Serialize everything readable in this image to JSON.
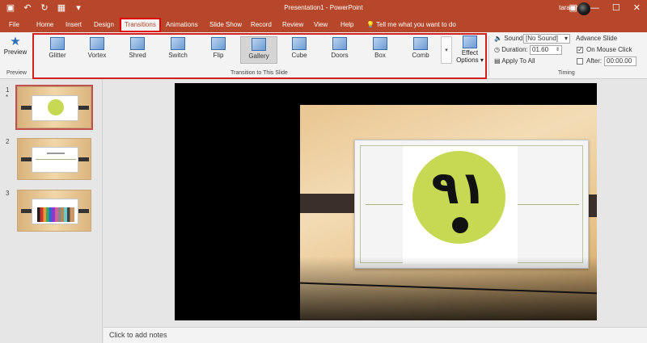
{
  "window": {
    "title": "Presentation1 - PowerPoint",
    "user": "taran n"
  },
  "tabs": [
    "File",
    "Home",
    "Insert",
    "Design",
    "Transitions",
    "Animations",
    "Slide Show",
    "Record",
    "Review",
    "View",
    "Help"
  ],
  "active_tab": "Transitions",
  "tell_me": "Tell me what you want to do",
  "ribbon": {
    "preview": {
      "label": "Preview",
      "group": "Preview"
    },
    "transitions": {
      "group": "Transition to This Slide",
      "items": [
        "Glitter",
        "Vortex",
        "Shred",
        "Switch",
        "Flip",
        "Gallery",
        "Cube",
        "Doors",
        "Box",
        "Comb"
      ],
      "selected": "Gallery",
      "effect_options_line1": "Effect",
      "effect_options_line2": "Options"
    },
    "timing": {
      "group": "Timing",
      "sound_label": "Sound:",
      "sound_value": "[No Sound]",
      "duration_label": "Duration:",
      "duration_value": "01.60",
      "apply_all": "Apply To All",
      "advance_label": "Advance Slide",
      "on_mouse_click": "On Mouse Click",
      "on_mouse_click_checked": true,
      "after_label": "After:",
      "after_value": "00:00.00",
      "after_checked": false
    }
  },
  "slides": [
    {
      "number": "1",
      "marker": "*",
      "active": true
    },
    {
      "number": "2",
      "marker": "",
      "active": false
    },
    {
      "number": "3",
      "marker": "",
      "active": false
    }
  ],
  "slide_logo_text": "۹۱",
  "notes_placeholder": "Click to add notes"
}
